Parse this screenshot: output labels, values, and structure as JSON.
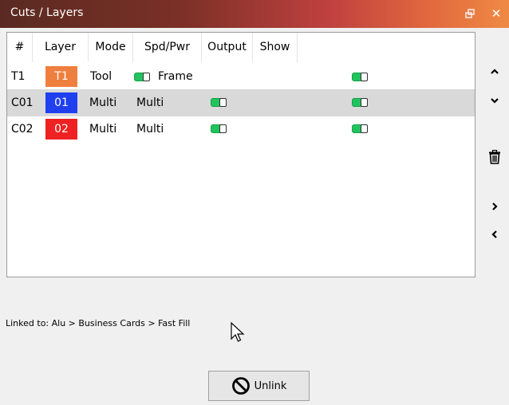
{
  "window": {
    "title": "Cuts / Layers",
    "float_icon": "float-window-icon",
    "close_icon": "close-icon",
    "close_glyph": "✕",
    "title_gradient": [
      "#5a2a22",
      "#c0413f",
      "#ef8a45"
    ]
  },
  "table": {
    "headers": [
      "#",
      "Layer",
      "Mode",
      "Spd/Pwr",
      "Output",
      "Show"
    ],
    "rows": [
      {
        "num": "T1",
        "layer": "T1",
        "layer_color": "#ef7f3f",
        "mode": "Tool",
        "spdpwr": "Frame",
        "spdpwr_toggle": true,
        "output_toggle": false,
        "show_toggle": true,
        "selected": false
      },
      {
        "num": "C01",
        "layer": "01",
        "layer_color": "#2040f0",
        "mode": "Multi",
        "spdpwr": "Multi",
        "spdpwr_toggle": false,
        "output_toggle": true,
        "show_toggle": true,
        "selected": true
      },
      {
        "num": "C02",
        "layer": "02",
        "layer_color": "#ee2222",
        "mode": "Multi",
        "spdpwr": "Multi",
        "spdpwr_toggle": false,
        "output_toggle": true,
        "show_toggle": true,
        "selected": false
      }
    ],
    "toggle_color": "#22c35e",
    "selected_row_color": "#d9d9d9"
  },
  "side_buttons": [
    "chevron-up-icon",
    "chevron-down-icon",
    "trash-icon",
    "chevron-right-icon",
    "chevron-left-icon"
  ],
  "linked": {
    "text": "Linked to: Alu > Business Cards > Fast Fill"
  },
  "unlink": {
    "label": "Unlink",
    "icon": "no-entry-icon"
  }
}
